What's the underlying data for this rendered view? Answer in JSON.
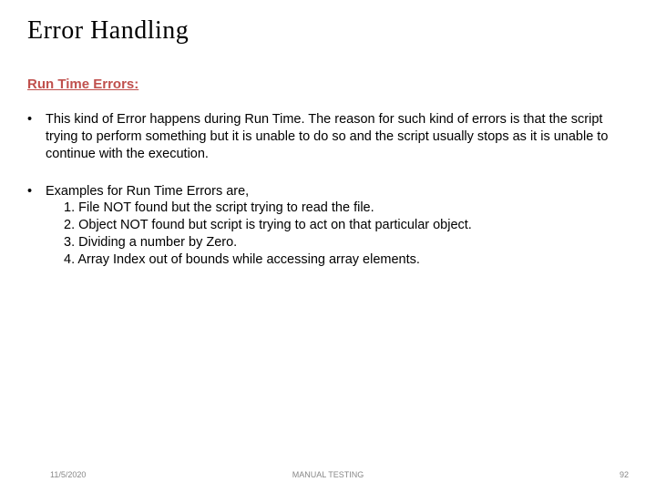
{
  "title": "Error Handling",
  "subheading": "Run Time Errors:",
  "bullets": [
    {
      "text": "This kind of Error happens during Run Time. The reason for such kind of errors is that the script trying to perform something but it is unable to do so and the script usually stops as it is unable to continue with the execution."
    },
    {
      "intro": "Examples for Run Time Errors are,",
      "items": [
        "1. File NOT found but the script trying to read the file.",
        "2. Object NOT found but script is trying to act on that particular object.",
        "3. Dividing a number by Zero.",
        "4. Array Index out of bounds while accessing array elements."
      ]
    }
  ],
  "footer": {
    "date": "11/5/2020",
    "center": "MANUAL TESTING",
    "page": "92"
  }
}
